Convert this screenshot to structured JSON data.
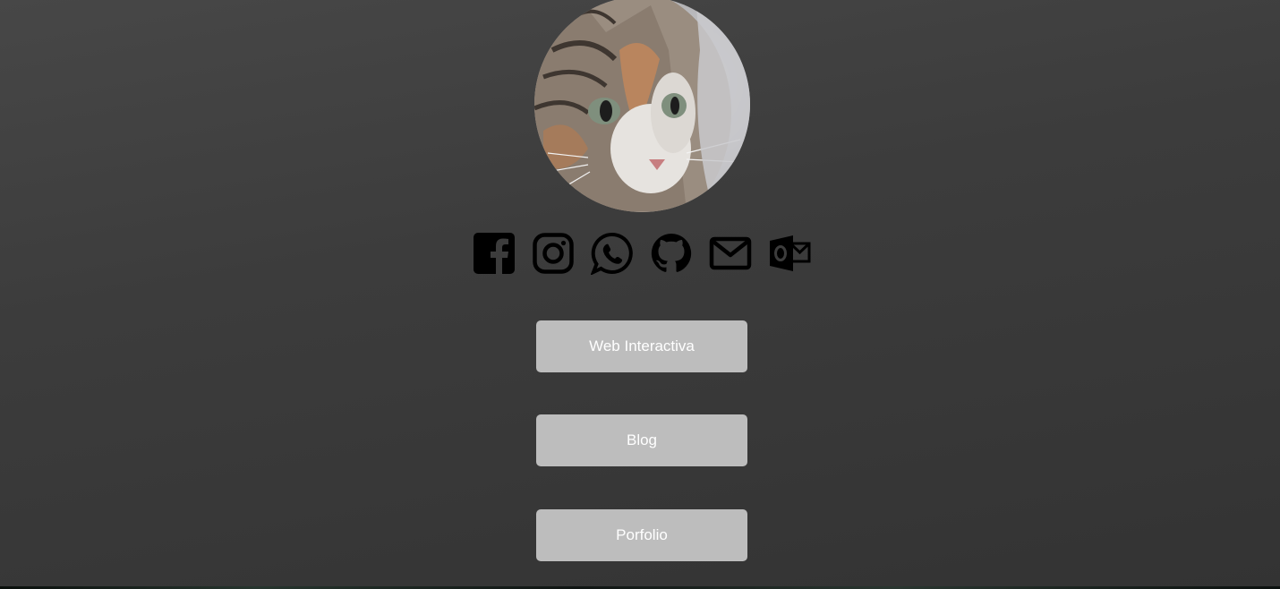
{
  "profile": {
    "avatar_icon": "cat-photo",
    "avatar_alt": ""
  },
  "socials": [
    {
      "name": "facebook",
      "icon": "facebook-icon"
    },
    {
      "name": "instagram",
      "icon": "instagram-icon"
    },
    {
      "name": "whatsapp",
      "icon": "whatsapp-icon"
    },
    {
      "name": "github",
      "icon": "github-icon"
    },
    {
      "name": "email",
      "icon": "mail-icon"
    },
    {
      "name": "outlook",
      "icon": "outlook-icon"
    }
  ],
  "links": [
    {
      "label": "Web Interactiva"
    },
    {
      "label": "Blog"
    },
    {
      "label": "Porfolio"
    }
  ],
  "colors": {
    "button_bg": "#bdbdbd",
    "button_text": "#ffffff",
    "icon": "#000000",
    "background": "#3a3a3a"
  }
}
